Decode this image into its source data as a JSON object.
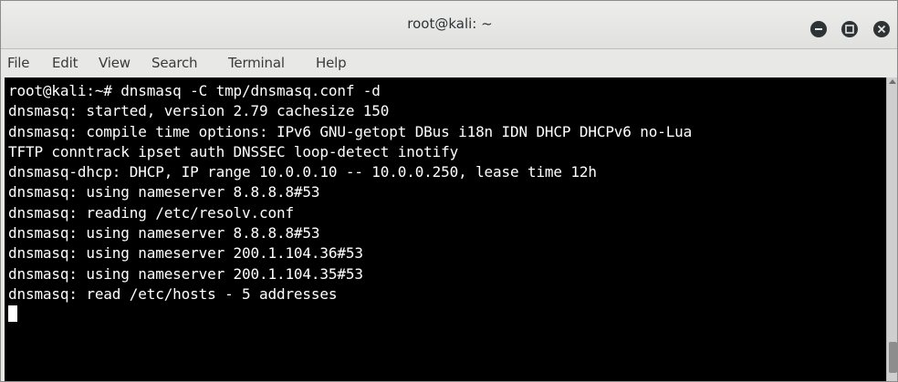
{
  "window": {
    "title": "root@kali: ~"
  },
  "menubar": {
    "items": [
      {
        "label": "File"
      },
      {
        "label": "Edit"
      },
      {
        "label": "View"
      },
      {
        "label": "Search"
      },
      {
        "label": "Terminal"
      },
      {
        "label": "Help"
      }
    ]
  },
  "terminal": {
    "prompt": "root@kali:~# ",
    "command": "dnsmasq -C tmp/dnsmasq.conf -d",
    "output": [
      "dnsmasq: started, version 2.79 cachesize 150",
      "dnsmasq: compile time options: IPv6 GNU-getopt DBus i18n IDN DHCP DHCPv6 no-Lua",
      "TFTP conntrack ipset auth DNSSEC loop-detect inotify",
      "dnsmasq-dhcp: DHCP, IP range 10.0.0.10 -- 10.0.0.250, lease time 12h",
      "dnsmasq: using nameserver 8.8.8.8#53",
      "dnsmasq: reading /etc/resolv.conf",
      "dnsmasq: using nameserver 8.8.8.8#53",
      "dnsmasq: using nameserver 200.1.104.36#53",
      "dnsmasq: using nameserver 200.1.104.35#53",
      "dnsmasq: read /etc/hosts - 5 addresses"
    ]
  },
  "colors": {
    "terminal_bg": "#000000",
    "terminal_fg": "#ffffff",
    "titlebar_bg": "#e8e8e7",
    "window_button": "#2e3436"
  },
  "icons": {
    "minimize": "minimize-icon",
    "maximize": "maximize-icon",
    "close": "close-icon"
  }
}
